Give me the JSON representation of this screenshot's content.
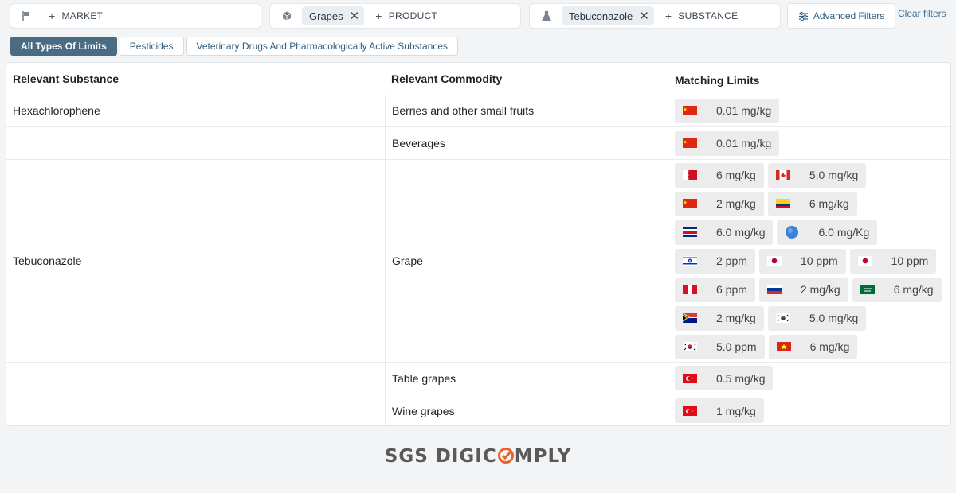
{
  "filters": {
    "market": {
      "add_label": "MARKET",
      "icon": "flag-icon"
    },
    "product": {
      "chip": "Grapes",
      "add_label": "PRODUCT",
      "icon": "box-icon"
    },
    "substance": {
      "chip": "Tebuconazole",
      "add_label": "SUBSTANCE",
      "icon": "flask-icon"
    },
    "advanced_label": "Advanced Filters",
    "clear_label": "Clear filters"
  },
  "tabs": [
    {
      "label": "All Types Of Limits",
      "active": true
    },
    {
      "label": "Pesticides",
      "active": false
    },
    {
      "label": "Veterinary Drugs And Pharmacologically Active Substances",
      "active": false
    }
  ],
  "table": {
    "headers": [
      "Relevant Substance",
      "Relevant Commodity",
      "Matching Limits"
    ],
    "rows": [
      {
        "substance": "Hexachlorophene",
        "commodity": "Berries and other small fruits",
        "limits": [
          [
            {
              "flag": "cn",
              "value": "0.01 mg/kg"
            }
          ]
        ]
      },
      {
        "substance": "",
        "commodity": "Beverages",
        "limits": [
          [
            {
              "flag": "cn",
              "value": "0.01 mg/kg"
            }
          ]
        ]
      },
      {
        "substance": "Tebuconazole",
        "commodity": "Grape",
        "limits": [
          [
            {
              "flag": "bh",
              "value": "6 mg/kg"
            },
            {
              "flag": "ca",
              "value": "5.0 mg/kg"
            }
          ],
          [
            {
              "flag": "cn",
              "value": "2 mg/kg"
            },
            {
              "flag": "co",
              "value": "6 mg/kg"
            }
          ],
          [
            {
              "flag": "cr",
              "value": "6.0 mg/kg"
            },
            {
              "flag": "circle",
              "value": "6.0 mg/Kg"
            }
          ],
          [
            {
              "flag": "il",
              "value": "2 ppm"
            },
            {
              "flag": "jp",
              "value": "10 ppm"
            },
            {
              "flag": "jp",
              "value": "10 ppm"
            }
          ],
          [
            {
              "flag": "pe",
              "value": "6 ppm"
            },
            {
              "flag": "ru",
              "value": "2 mg/kg"
            },
            {
              "flag": "sa",
              "value": "6 mg/kg"
            }
          ],
          [
            {
              "flag": "za",
              "value": "2 mg/kg"
            },
            {
              "flag": "kr",
              "value": "5.0 mg/kg"
            }
          ],
          [
            {
              "flag": "kr",
              "value": "5.0 ppm"
            },
            {
              "flag": "vn",
              "value": "6 mg/kg"
            }
          ]
        ]
      },
      {
        "substance": "",
        "commodity": "Table grapes",
        "limits": [
          [
            {
              "flag": "tr",
              "value": "0.5 mg/kg"
            }
          ]
        ]
      },
      {
        "substance": "",
        "commodity": "Wine grapes",
        "limits": [
          [
            {
              "flag": "tr",
              "value": "1 mg/kg"
            }
          ]
        ]
      }
    ]
  },
  "logo": {
    "left": "SGS DIGIC",
    "right": "MPLY",
    "accent_color": "#e8632b"
  },
  "colors": {
    "accent": "#4a6b84",
    "link": "#2f5d80",
    "background": "#f2f4f6"
  }
}
